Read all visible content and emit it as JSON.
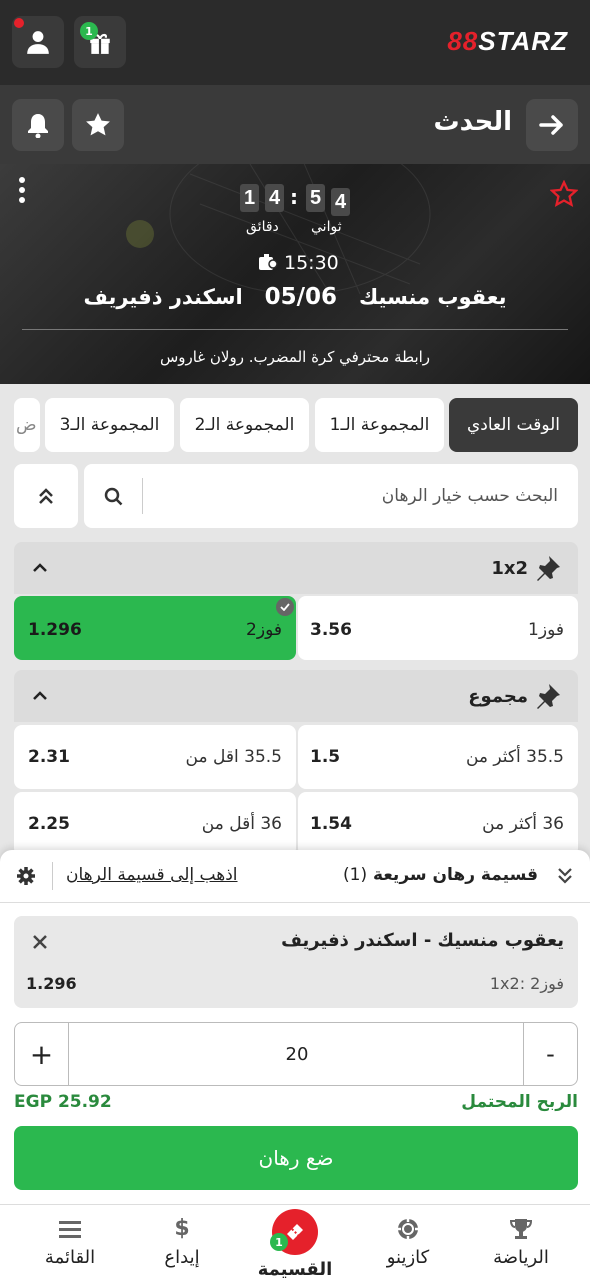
{
  "header": {
    "logo_prefix": "88",
    "logo_text": "STARZ",
    "gift_badge": "1"
  },
  "event_bar": {
    "title": "الحدث"
  },
  "match": {
    "timer": {
      "sec_tens": "5",
      "sec_ones": "4",
      "min_tens": "1",
      "min_ones": "4"
    },
    "seconds_label": "ثواني",
    "minutes_label": "دقائق",
    "time": "15:30",
    "home": "يعقوب منسيك",
    "away": "اسكندر ذفيريف",
    "date": "05/06",
    "league": "رابطة محترفي كرة المضرب. رولان غاروس"
  },
  "tabs": [
    "الوقت العادي",
    "المجموعة الـ1",
    "المجموعة الـ2",
    "المجموعة الـ3",
    "ض"
  ],
  "search": {
    "placeholder": "البحث حسب خيار الرهان"
  },
  "markets": {
    "m1x2": {
      "title": "1x2",
      "odds": [
        {
          "name": "فوز1",
          "value": "3.56"
        },
        {
          "name": "فوز2",
          "value": "1.296"
        }
      ]
    },
    "total": {
      "title": "مجموع",
      "odds": [
        {
          "name": "35.5 أكثر من",
          "value": "1.5"
        },
        {
          "name": "35.5 اقل من",
          "value": "2.31"
        },
        {
          "name": "36 أكثر من",
          "value": "1.54"
        },
        {
          "name": "36 أقل من",
          "value": "2.25"
        }
      ]
    }
  },
  "slip": {
    "title": "قسيمة رهان سريعة",
    "count": "(1)",
    "link": "اذهب إلى قسيمة الرهان",
    "event": "يعقوب منسيك - اسكندر ذفيريف",
    "selection": "1x2: فوز2",
    "odd": "1.296",
    "stake": "20",
    "minus": "-",
    "plus": "+",
    "win_label": "الربح المحتمل",
    "win_value": "EGP 25.92",
    "place_bet": "ضع رهان"
  },
  "nav": {
    "sports": "الرياضة",
    "casino": "كازينو",
    "slip": "القسيمة",
    "slip_badge": "1",
    "deposit": "إيداع",
    "menu": "القائمة"
  },
  "colors": {
    "accent_green": "#2bb84f",
    "brand_red": "#e5212b",
    "dark_bar": "#2b2b2b"
  }
}
